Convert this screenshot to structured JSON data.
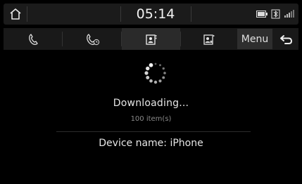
{
  "status_bar": {
    "time": "05:14",
    "icons": [
      "home-icon",
      "battery-icon",
      "bluetooth-icon",
      "signal-icon"
    ]
  },
  "tabs": [
    {
      "id": "call-history",
      "icon": "phone-icon",
      "active": false
    },
    {
      "id": "recent-calls",
      "icon": "phone-clock-icon",
      "active": false
    },
    {
      "id": "contacts",
      "icon": "contacts-icon",
      "active": true
    },
    {
      "id": "favorites",
      "icon": "favorite-contacts-icon",
      "active": false
    }
  ],
  "menu_label": "Menu",
  "download": {
    "status": "Downloading...",
    "count": "100 item(s)"
  },
  "device": {
    "label": "Device name: iPhone"
  },
  "colors": {
    "background": "#000000",
    "bar": "#1b1b1b",
    "active_tab": "#2a2a2a",
    "muted_text": "#8a8a8a"
  }
}
